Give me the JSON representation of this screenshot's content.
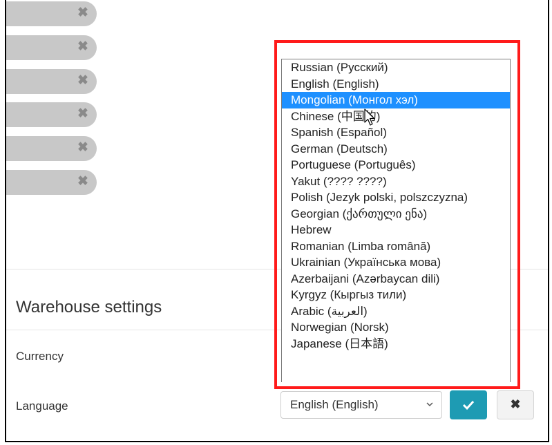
{
  "removable_items": [
    {
      "remove_icon": "✖"
    },
    {
      "remove_icon": "✖"
    },
    {
      "remove_icon": "✖"
    },
    {
      "remove_icon": "✖"
    },
    {
      "remove_icon": "✖"
    },
    {
      "remove_icon": "✖"
    }
  ],
  "warehouse": {
    "title": "Warehouse settings",
    "currency_label": "Currency",
    "language_label": "Language",
    "language_selected": "English (English)",
    "confirm_icon": "check-icon",
    "cancel_icon": "✖"
  },
  "language_dropdown": {
    "highlighted": "Mongolian (Монгол хэл)",
    "options": [
      "Russian (Русский)",
      "English (English)",
      "Mongolian (Монгол хэл)",
      "Chinese (中国的)",
      "Spanish (Español)",
      "German (Deutsch)",
      "Portuguese (Português)",
      "Yakut (???? ????)",
      "Polish (Jezyk polski, polszczyzna)",
      "Georgian (ქართული ენა)",
      "Hebrew",
      "Romanian (Limba română)",
      "Ukrainian (Українська мова)",
      "Azerbaijani (Azərbaycan dili)",
      "Kyrgyz (Кыргыз тили)",
      "Arabic (العربية)",
      "Norwegian (Norsk)",
      "Japanese (日本語)"
    ]
  },
  "colors": {
    "highlight_border": "#ff1a1a",
    "selected_option": "#1e90ff",
    "confirm_button": "#1e9bb3"
  }
}
